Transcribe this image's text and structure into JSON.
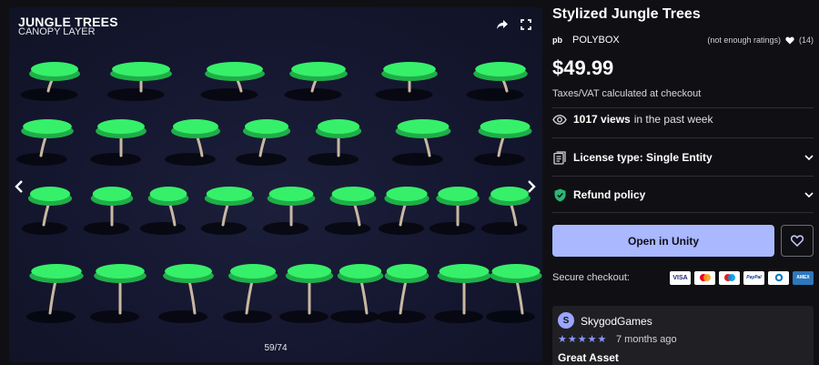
{
  "gallery": {
    "title": "JUNGLE TREES",
    "subtitle": "CANOPY LAYER",
    "counter": "59/74",
    "share_icon": "share-icon",
    "fullscreen_icon": "fullscreen-icon",
    "prev_icon": "chevron-left-icon",
    "next_icon": "chevron-right-icon",
    "colors": {
      "canopy": "#36f06a",
      "canopy_dark": "#1fae48",
      "trunk": "#c9b8a0",
      "background": "#171a33"
    }
  },
  "product": {
    "title": "Stylized Jungle Trees",
    "seller_logo": "pb",
    "seller": "POLYBOX",
    "ratings_note": "(not enough ratings)",
    "favorites": "(14)",
    "price": "$49.99",
    "tax_note": "Taxes/VAT calculated at checkout",
    "views_count": "1017 views",
    "views_suffix": "in the past week",
    "license": "License type: Single Entity",
    "refund": "Refund policy",
    "open_button": "Open in Unity",
    "secure_label": "Secure checkout:",
    "payment_methods": [
      "VISA",
      "MC",
      "Maestro",
      "PayPal",
      "Diners",
      "AMEX"
    ]
  },
  "review": {
    "avatar_letter": "S",
    "author": "SkygodGames",
    "stars": "★★★★★",
    "time": "7 months ago",
    "title": "Great Asset"
  }
}
